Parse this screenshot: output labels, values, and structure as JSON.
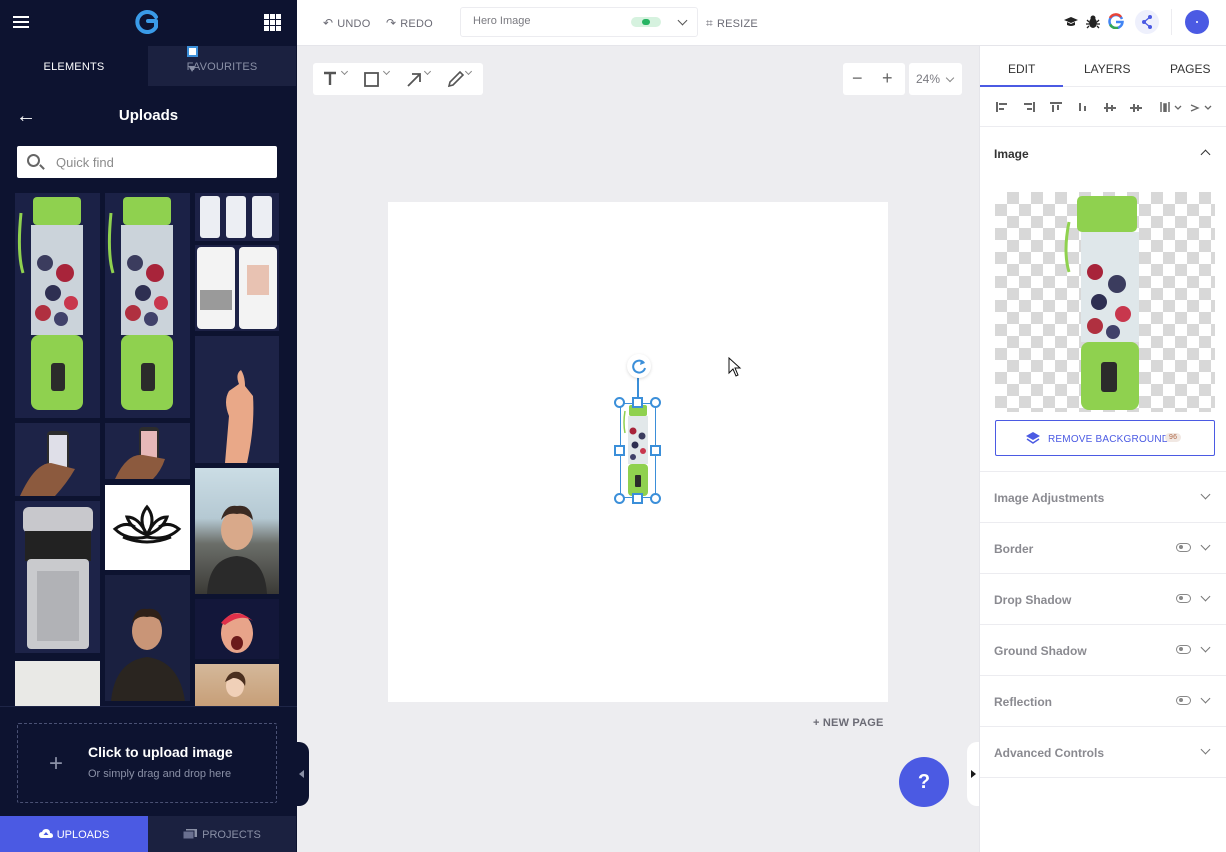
{
  "sidebar": {
    "tabs": {
      "elements": "ELEMENTS",
      "favourites": "FAVOURITES"
    },
    "title": "Uploads",
    "search_placeholder": "Quick find",
    "upload": {
      "title": "Click to upload image",
      "subtitle": "Or simply drag and drop here"
    },
    "bottom_tabs": {
      "uploads": "UPLOADS",
      "projects": "PROJECTS"
    }
  },
  "topbar": {
    "undo": "UNDO",
    "redo": "REDO",
    "document_name": "Hero Image",
    "resize": "RESIZE"
  },
  "canvas": {
    "zoom": "24%",
    "new_page": "NEW PAGE",
    "help": "?"
  },
  "right_panel": {
    "tabs": {
      "edit": "EDIT",
      "layers": "LAYERS",
      "pages": "PAGES"
    },
    "image_section": "Image",
    "remove_background": "REMOVE BACKGROUND",
    "remove_background_credits": "96",
    "sections": {
      "adjustments": "Image Adjustments",
      "border": "Border",
      "drop_shadow": "Drop Shadow",
      "ground_shadow": "Ground Shadow",
      "reflection": "Reflection",
      "advanced": "Advanced Controls"
    }
  },
  "colors": {
    "accent": "#4b5ae3",
    "sidebar": "#0d1330",
    "selection": "#3b8fd9"
  }
}
